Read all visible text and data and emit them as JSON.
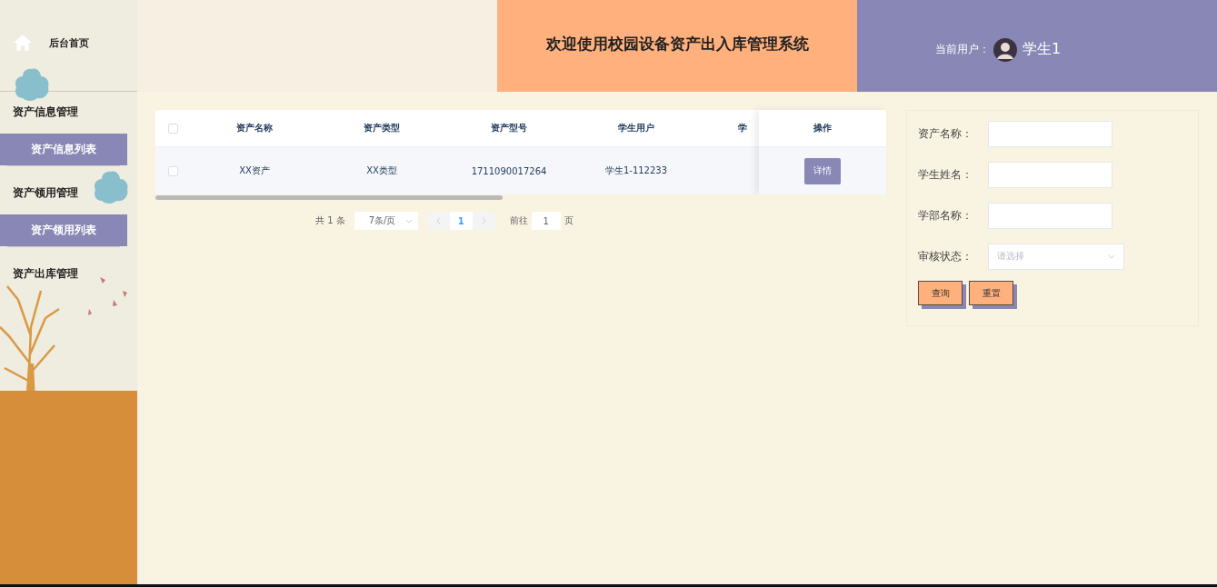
{
  "sidebar": {
    "home": {
      "label": "后台首页"
    },
    "groups": [
      {
        "label": "资产信息管理",
        "items": [
          {
            "label": "资产信息列表",
            "selected": true
          }
        ]
      },
      {
        "label": "资产领用管理",
        "items": [
          {
            "label": "资产领用列表",
            "selected": true
          }
        ]
      },
      {
        "label": "资产出库管理"
      }
    ]
  },
  "header": {
    "title": "欢迎使用校园设备资产出入库管理系统",
    "user_label": "当前用户：",
    "user_name": "学生1"
  },
  "table": {
    "select_all_checked": false,
    "columns": [
      "资产名称",
      "资产类型",
      "资产型号",
      "学生用户",
      "学"
    ],
    "action_column": "操作",
    "rows": [
      {
        "checked": false,
        "cells": [
          "XX资产",
          "XX类型",
          "1711090017264",
          "学生1-112233"
        ],
        "action": "详情"
      }
    ]
  },
  "pagination": {
    "total": "共 1 条",
    "page_size": "7条/页",
    "pages": [
      {
        "label": "1",
        "selected": true
      }
    ],
    "goto_label": "前往",
    "goto_value": "1",
    "page_suffix": "页"
  },
  "search": {
    "fields": [
      {
        "label": "资产名称：",
        "kind": "text"
      },
      {
        "label": "学生姓名：",
        "kind": "text"
      },
      {
        "label": "学部名称：",
        "kind": "text"
      },
      {
        "label": "审核状态：",
        "kind": "select",
        "placeholder": "请选择"
      }
    ],
    "buttons": [
      "查询",
      "重置"
    ]
  }
}
